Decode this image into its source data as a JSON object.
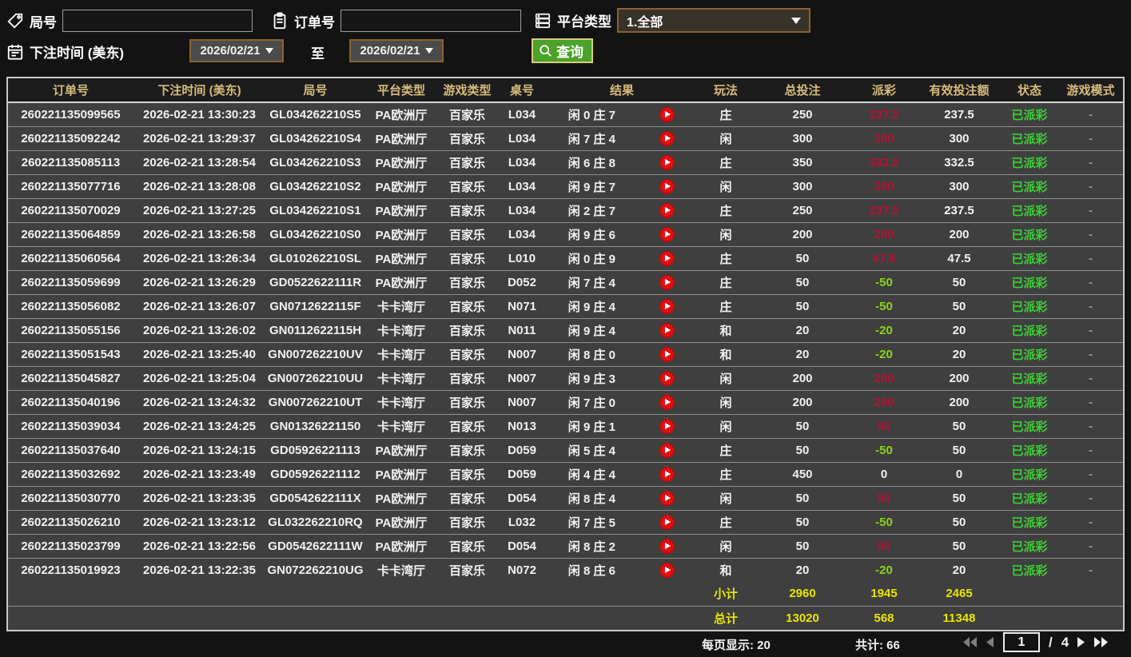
{
  "colors": {
    "win_red": "#b51235",
    "loss_green": "#8bd41e",
    "status_green": "#3ecf35",
    "total_yellow": "#e9e600",
    "header_gold": "#d8bc7a",
    "field_border_brown": "#8a6330",
    "query_button_green": "#4aa228",
    "play_button_red": "#e11212"
  },
  "filters": {
    "game_no": {
      "label": "局号",
      "value": "",
      "icon": "tag-icon"
    },
    "order_no": {
      "label": "订单号",
      "value": "",
      "icon": "clipboard-icon"
    },
    "platform_type": {
      "label": "平台类型",
      "value": "1.全部",
      "icon": "server-icon"
    },
    "bet_time": {
      "label": "下注时间 (美东)",
      "from": "2026/02/21",
      "to_label": "至",
      "to": "2026/02/21",
      "icon": "calendar-icon"
    },
    "query_button": "查询"
  },
  "table": {
    "columns": [
      "订单号",
      "下注时间 (美东)",
      "局号",
      "平台类型",
      "游戏类型",
      "桌号",
      "结果",
      "玩法",
      "总投注",
      "派彩",
      "有效投注额",
      "状态",
      "游戏模式"
    ],
    "rows": [
      {
        "order_no": "260221135099565",
        "bet_time": "2026-02-21 13:30:23",
        "game_no": "GL034262210S5",
        "platform": "PA欧洲厅",
        "game_type": "百家乐",
        "table_no": "L034",
        "result": "闲 0 庄 7",
        "play": "庄",
        "total_bet": "250",
        "payout": "237.5",
        "payout_color": "win",
        "valid_bet": "237.5",
        "status": "已派彩",
        "mode": "-"
      },
      {
        "order_no": "260221135092242",
        "bet_time": "2026-02-21 13:29:37",
        "game_no": "GL034262210S4",
        "platform": "PA欧洲厅",
        "game_type": "百家乐",
        "table_no": "L034",
        "result": "闲 7 庄 4",
        "play": "闲",
        "total_bet": "300",
        "payout": "300",
        "payout_color": "win",
        "valid_bet": "300",
        "status": "已派彩",
        "mode": "-"
      },
      {
        "order_no": "260221135085113",
        "bet_time": "2026-02-21 13:28:54",
        "game_no": "GL034262210S3",
        "platform": "PA欧洲厅",
        "game_type": "百家乐",
        "table_no": "L034",
        "result": "闲 6 庄 8",
        "play": "庄",
        "total_bet": "350",
        "payout": "332.5",
        "payout_color": "win",
        "valid_bet": "332.5",
        "status": "已派彩",
        "mode": "-"
      },
      {
        "order_no": "260221135077716",
        "bet_time": "2026-02-21 13:28:08",
        "game_no": "GL034262210S2",
        "platform": "PA欧洲厅",
        "game_type": "百家乐",
        "table_no": "L034",
        "result": "闲 9 庄 7",
        "play": "闲",
        "total_bet": "300",
        "payout": "300",
        "payout_color": "win",
        "valid_bet": "300",
        "status": "已派彩",
        "mode": "-"
      },
      {
        "order_no": "260221135070029",
        "bet_time": "2026-02-21 13:27:25",
        "game_no": "GL034262210S1",
        "platform": "PA欧洲厅",
        "game_type": "百家乐",
        "table_no": "L034",
        "result": "闲 2 庄 7",
        "play": "庄",
        "total_bet": "250",
        "payout": "237.5",
        "payout_color": "win",
        "valid_bet": "237.5",
        "status": "已派彩",
        "mode": "-"
      },
      {
        "order_no": "260221135064859",
        "bet_time": "2026-02-21 13:26:58",
        "game_no": "GL034262210S0",
        "platform": "PA欧洲厅",
        "game_type": "百家乐",
        "table_no": "L034",
        "result": "闲 9 庄 6",
        "play": "闲",
        "total_bet": "200",
        "payout": "200",
        "payout_color": "win",
        "valid_bet": "200",
        "status": "已派彩",
        "mode": "-"
      },
      {
        "order_no": "260221135060564",
        "bet_time": "2026-02-21 13:26:34",
        "game_no": "GL010262210SL",
        "platform": "PA欧洲厅",
        "game_type": "百家乐",
        "table_no": "L010",
        "result": "闲 0 庄 9",
        "play": "庄",
        "total_bet": "50",
        "payout": "47.5",
        "payout_color": "win",
        "valid_bet": "47.5",
        "status": "已派彩",
        "mode": "-"
      },
      {
        "order_no": "260221135059699",
        "bet_time": "2026-02-21 13:26:29",
        "game_no": "GD0522622111R",
        "platform": "PA欧洲厅",
        "game_type": "百家乐",
        "table_no": "D052",
        "result": "闲 7 庄 4",
        "play": "庄",
        "total_bet": "50",
        "payout": "-50",
        "payout_color": "loss",
        "valid_bet": "50",
        "status": "已派彩",
        "mode": "-"
      },
      {
        "order_no": "260221135056082",
        "bet_time": "2026-02-21 13:26:07",
        "game_no": "GN0712622115F",
        "platform": "卡卡湾厅",
        "game_type": "百家乐",
        "table_no": "N071",
        "result": "闲 9 庄 4",
        "play": "庄",
        "total_bet": "50",
        "payout": "-50",
        "payout_color": "loss",
        "valid_bet": "50",
        "status": "已派彩",
        "mode": "-"
      },
      {
        "order_no": "260221135055156",
        "bet_time": "2026-02-21 13:26:02",
        "game_no": "GN0112622115H",
        "platform": "卡卡湾厅",
        "game_type": "百家乐",
        "table_no": "N011",
        "result": "闲 9 庄 4",
        "play": "和",
        "total_bet": "20",
        "payout": "-20",
        "payout_color": "loss",
        "valid_bet": "20",
        "status": "已派彩",
        "mode": "-"
      },
      {
        "order_no": "260221135051543",
        "bet_time": "2026-02-21 13:25:40",
        "game_no": "GN007262210UV",
        "platform": "卡卡湾厅",
        "game_type": "百家乐",
        "table_no": "N007",
        "result": "闲 8 庄 0",
        "play": "和",
        "total_bet": "20",
        "payout": "-20",
        "payout_color": "loss",
        "valid_bet": "20",
        "status": "已派彩",
        "mode": "-"
      },
      {
        "order_no": "260221135045827",
        "bet_time": "2026-02-21 13:25:04",
        "game_no": "GN007262210UU",
        "platform": "卡卡湾厅",
        "game_type": "百家乐",
        "table_no": "N007",
        "result": "闲 9 庄 3",
        "play": "闲",
        "total_bet": "200",
        "payout": "200",
        "payout_color": "win",
        "valid_bet": "200",
        "status": "已派彩",
        "mode": "-"
      },
      {
        "order_no": "260221135040196",
        "bet_time": "2026-02-21 13:24:32",
        "game_no": "GN007262210UT",
        "platform": "卡卡湾厅",
        "game_type": "百家乐",
        "table_no": "N007",
        "result": "闲 7 庄 0",
        "play": "闲",
        "total_bet": "200",
        "payout": "200",
        "payout_color": "win",
        "valid_bet": "200",
        "status": "已派彩",
        "mode": "-"
      },
      {
        "order_no": "260221135039034",
        "bet_time": "2026-02-21 13:24:25",
        "game_no": "GN01326221150",
        "platform": "卡卡湾厅",
        "game_type": "百家乐",
        "table_no": "N013",
        "result": "闲 9 庄 1",
        "play": "闲",
        "total_bet": "50",
        "payout": "50",
        "payout_color": "win",
        "valid_bet": "50",
        "status": "已派彩",
        "mode": "-"
      },
      {
        "order_no": "260221135037640",
        "bet_time": "2026-02-21 13:24:15",
        "game_no": "GD05926221113",
        "platform": "PA欧洲厅",
        "game_type": "百家乐",
        "table_no": "D059",
        "result": "闲 5 庄 4",
        "play": "庄",
        "total_bet": "50",
        "payout": "-50",
        "payout_color": "loss",
        "valid_bet": "50",
        "status": "已派彩",
        "mode": "-"
      },
      {
        "order_no": "260221135032692",
        "bet_time": "2026-02-21 13:23:49",
        "game_no": "GD05926221112",
        "platform": "PA欧洲厅",
        "game_type": "百家乐",
        "table_no": "D059",
        "result": "闲 4 庄 4",
        "play": "庄",
        "total_bet": "450",
        "payout": "0",
        "payout_color": "even",
        "valid_bet": "0",
        "status": "已派彩",
        "mode": "-"
      },
      {
        "order_no": "260221135030770",
        "bet_time": "2026-02-21 13:23:35",
        "game_no": "GD0542622111X",
        "platform": "PA欧洲厅",
        "game_type": "百家乐",
        "table_no": "D054",
        "result": "闲 8 庄 4",
        "play": "闲",
        "total_bet": "50",
        "payout": "50",
        "payout_color": "win",
        "valid_bet": "50",
        "status": "已派彩",
        "mode": "-"
      },
      {
        "order_no": "260221135026210",
        "bet_time": "2026-02-21 13:23:12",
        "game_no": "GL032262210RQ",
        "platform": "PA欧洲厅",
        "game_type": "百家乐",
        "table_no": "L032",
        "result": "闲 7 庄 5",
        "play": "庄",
        "total_bet": "50",
        "payout": "-50",
        "payout_color": "loss",
        "valid_bet": "50",
        "status": "已派彩",
        "mode": "-"
      },
      {
        "order_no": "260221135023799",
        "bet_time": "2026-02-21 13:22:56",
        "game_no": "GD0542622111W",
        "platform": "PA欧洲厅",
        "game_type": "百家乐",
        "table_no": "D054",
        "result": "闲 8 庄 2",
        "play": "闲",
        "total_bet": "50",
        "payout": "50",
        "payout_color": "win",
        "valid_bet": "50",
        "status": "已派彩",
        "mode": "-"
      },
      {
        "order_no": "260221135019923",
        "bet_time": "2026-02-21 13:22:35",
        "game_no": "GN072262210UG",
        "platform": "卡卡湾厅",
        "game_type": "百家乐",
        "table_no": "N072",
        "result": "闲 8 庄 6",
        "play": "和",
        "total_bet": "20",
        "payout": "-20",
        "payout_color": "loss",
        "valid_bet": "20",
        "status": "已派彩",
        "mode": "-"
      }
    ],
    "subtotal": {
      "label": "小计",
      "total_bet": "2960",
      "payout": "1945",
      "valid_bet": "2465"
    },
    "grand_total": {
      "label": "总计",
      "total_bet": "13020",
      "payout": "568",
      "valid_bet": "11348"
    }
  },
  "footer": {
    "per_page_label": "每页显示:",
    "per_page_value": "20",
    "total_label": "共计:",
    "total_value": "66",
    "page_current": "1",
    "page_separator": "/",
    "page_total": "4"
  }
}
